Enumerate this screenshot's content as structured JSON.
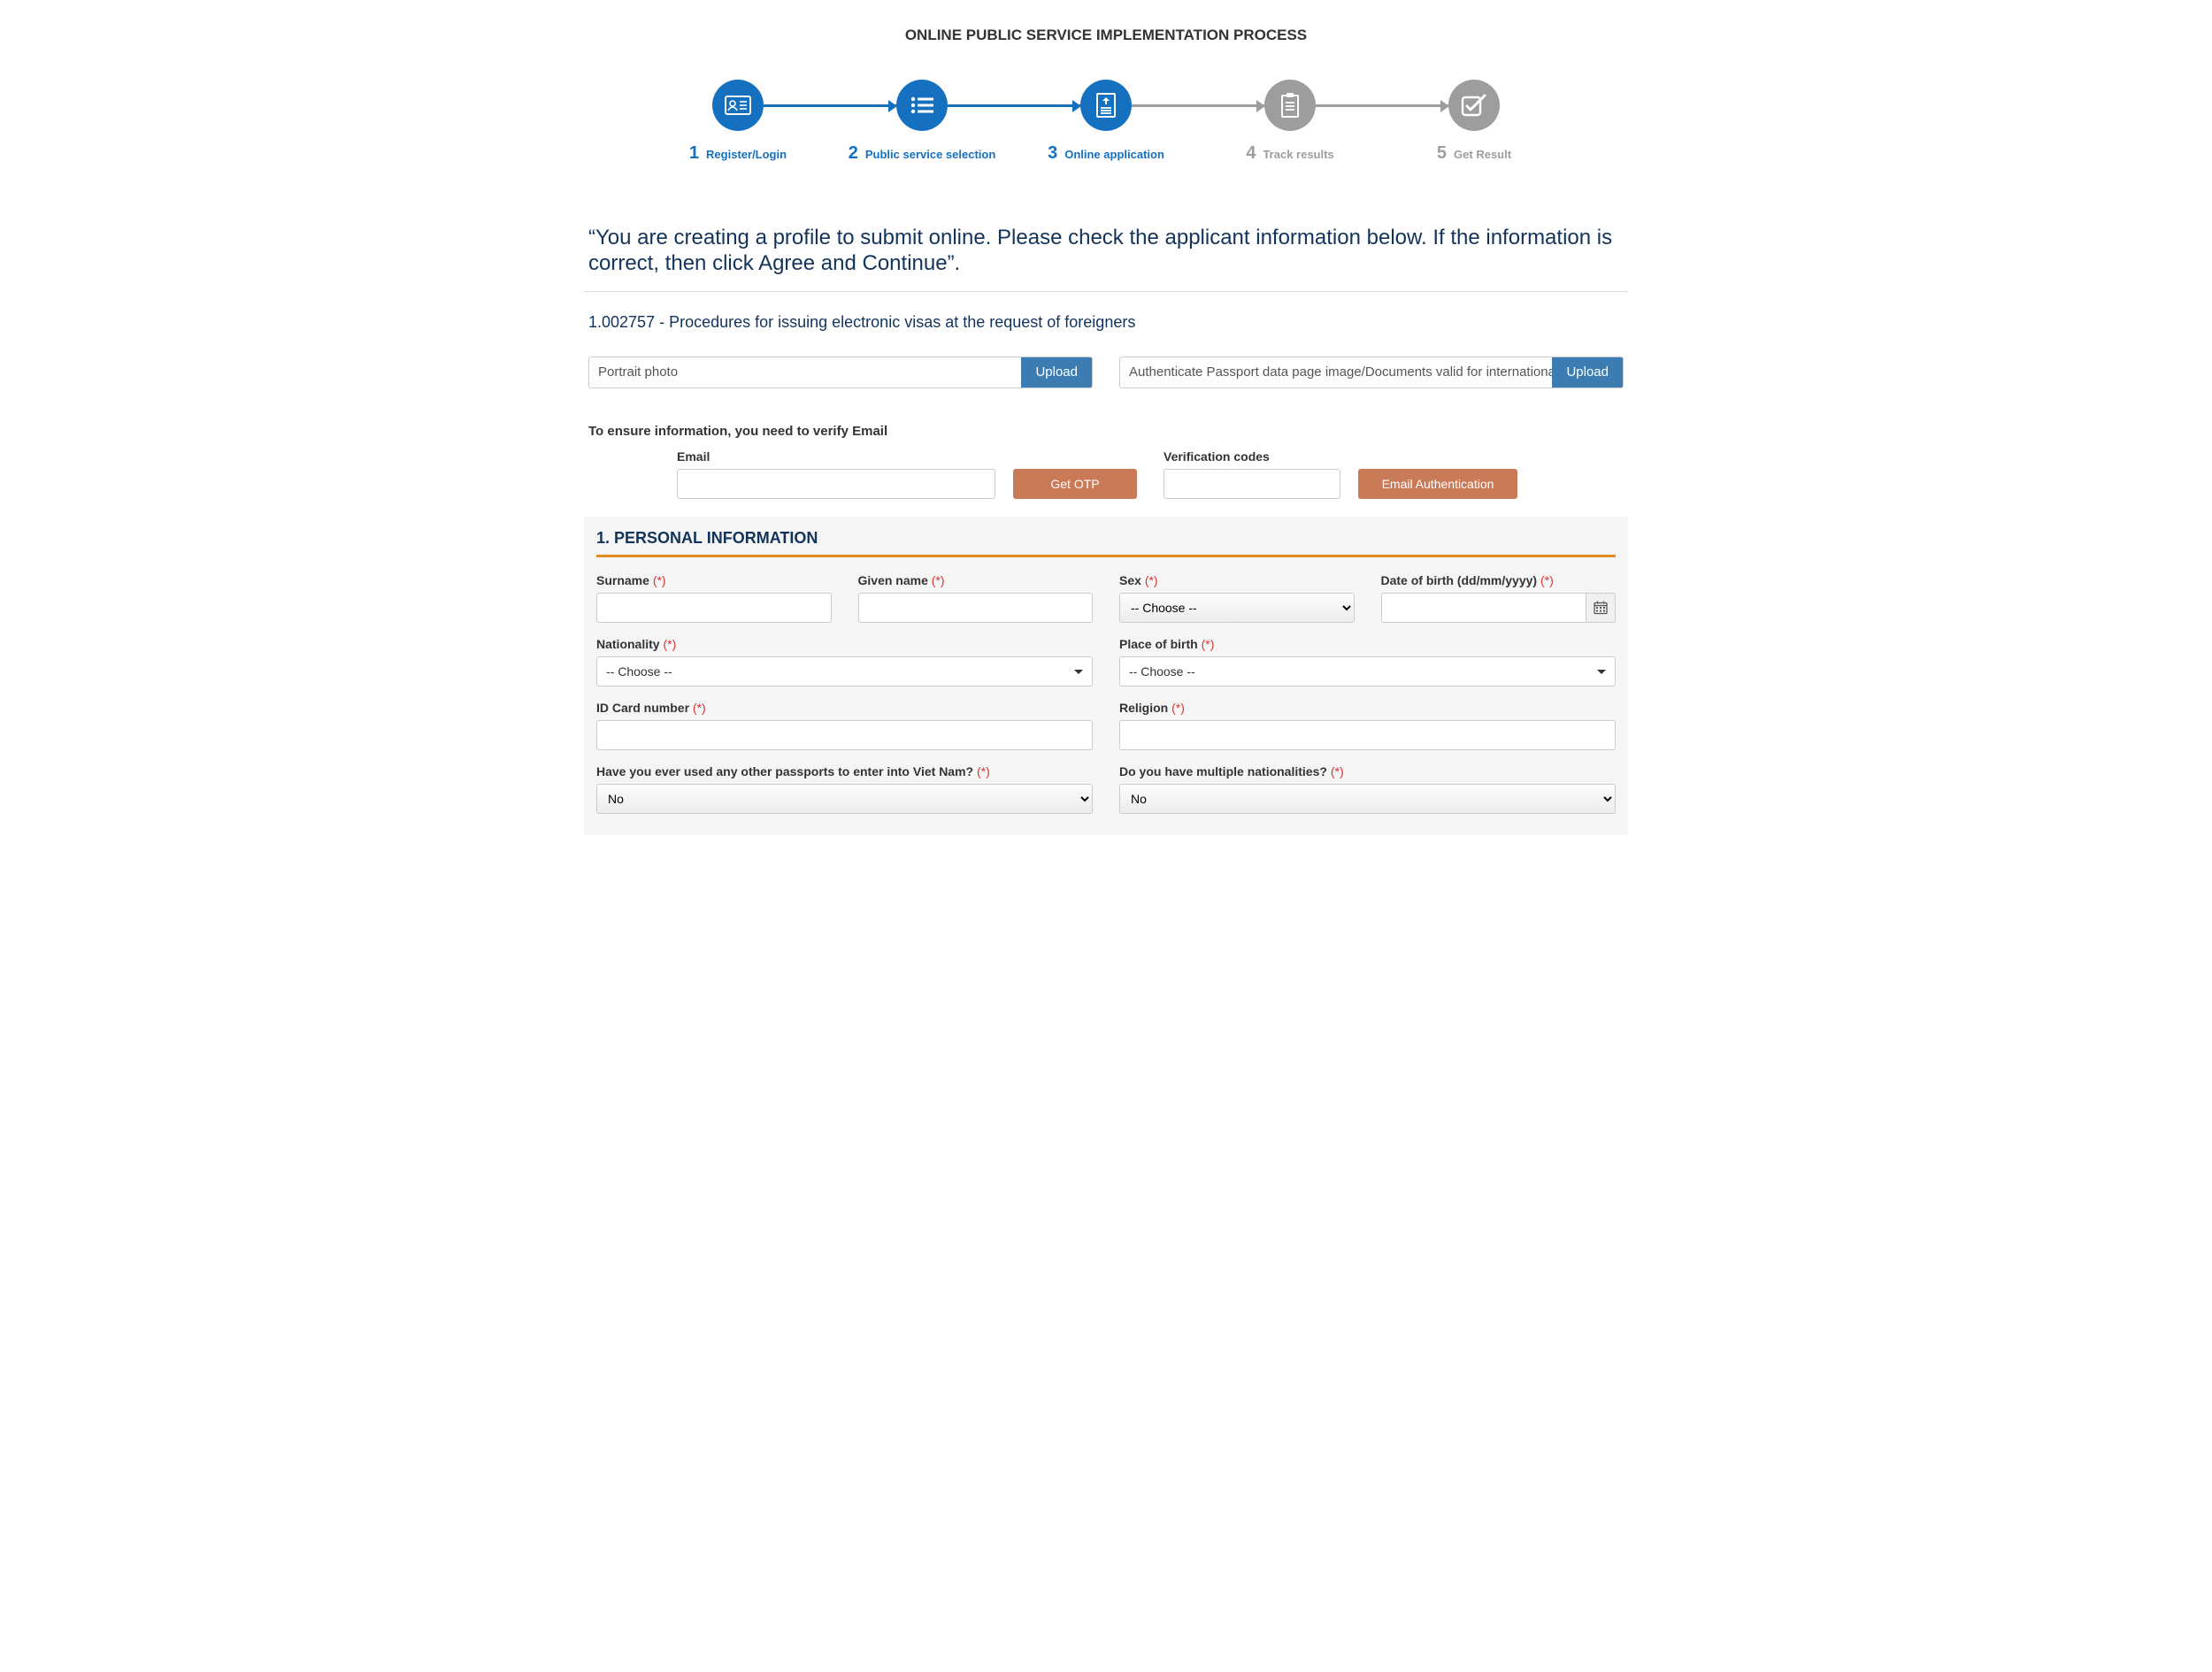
{
  "page_title": "ONLINE PUBLIC SERVICE IMPLEMENTATION PROCESS",
  "stepper": [
    {
      "num": "1",
      "label": "Register/Login",
      "state": "active",
      "icon": "id-card-icon",
      "line": "active"
    },
    {
      "num": "2",
      "label": "Public service selection",
      "state": "active",
      "icon": "list-icon",
      "line": "active"
    },
    {
      "num": "3",
      "label": "Online application",
      "state": "active",
      "icon": "document-up-icon",
      "line": "inactive"
    },
    {
      "num": "4",
      "label": "Track results",
      "state": "inactive",
      "icon": "clipboard-icon",
      "line": "inactive"
    },
    {
      "num": "5",
      "label": "Get Result",
      "state": "inactive",
      "icon": "check-box-icon",
      "line": ""
    }
  ],
  "intro_text": "“You are creating a profile to submit online. Please check the applicant information below. If the information is correct, then click Agree and Continue”.",
  "procedure_title": "1.002757 - Procedures for issuing electronic visas at the request of foreigners",
  "uploads": {
    "portrait": {
      "placeholder": "Portrait photo",
      "button": "Upload"
    },
    "passport": {
      "placeholder": "Authenticate Passport data page image/Documents valid for international travel",
      "button": "Upload"
    }
  },
  "verify": {
    "note": "To ensure information, you need to verify Email",
    "email_label": "Email",
    "get_otp": "Get OTP",
    "code_label": "Verification codes",
    "auth_btn": "Email Authentication"
  },
  "personal": {
    "title": "1. PERSONAL INFORMATION",
    "required_mark": "(*)",
    "choose": "-- Choose --",
    "no": "No",
    "labels": {
      "surname": "Surname",
      "given_name": "Given name",
      "sex": "Sex",
      "dob": "Date of birth (dd/mm/yyyy)",
      "nationality": "Nationality",
      "pob": "Place of birth",
      "id_card": "ID Card number",
      "religion": "Religion",
      "other_passports": "Have you ever used any other passports to enter into Viet Nam?",
      "multi_nat": "Do you have multiple nationalities?"
    }
  }
}
